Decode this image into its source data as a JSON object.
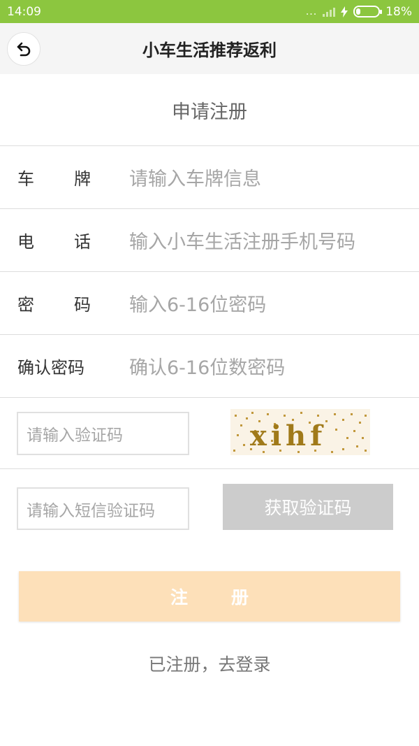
{
  "status_bar": {
    "time": "14:09",
    "dots": "...",
    "battery_text": "18%",
    "battery_level": 0.18
  },
  "header": {
    "title": "小车生活推荐返利",
    "back_icon": "back-arrow-icon"
  },
  "page": {
    "section_title": "申请注册"
  },
  "form": {
    "plate": {
      "label_a": "车",
      "label_b": "牌",
      "placeholder": "请输入车牌信息"
    },
    "phone": {
      "label_a": "电",
      "label_b": "话",
      "placeholder": "输入小车生活注册手机号码"
    },
    "password": {
      "label_a": "密",
      "label_b": "码",
      "placeholder": "输入6-16位密码"
    },
    "confirm": {
      "label": "确认密码",
      "placeholder": "确认6-16位数密码"
    },
    "captcha": {
      "placeholder": "请输入验证码",
      "image_text": "xihf"
    },
    "sms": {
      "placeholder": "请输入短信验证码",
      "button_label": "获取验证码"
    }
  },
  "actions": {
    "register_a": "注",
    "register_b": "册",
    "login_link": "已注册，去登录"
  },
  "colors": {
    "status_bar": "#8cc63f",
    "register_button": "#fde0b9",
    "sms_button": "#cccccc",
    "captcha_text": "#a07a1a"
  }
}
